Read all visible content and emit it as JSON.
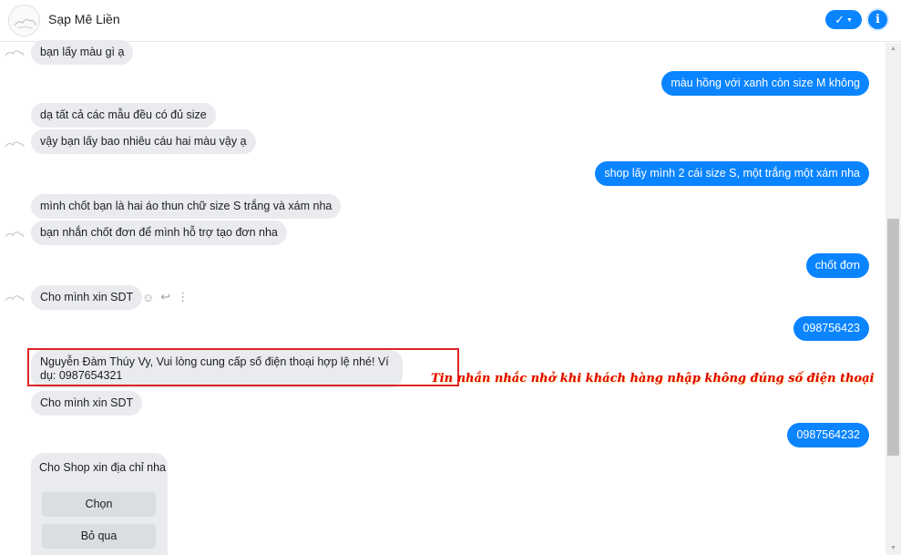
{
  "header": {
    "title": "Sạp Mê Liền",
    "check_icon": "check-icon",
    "info_icon": "info-icon",
    "accent_color": "#0a84ff"
  },
  "messages": [
    {
      "side": "incoming",
      "text": "bạn lấy màu gì ạ"
    },
    {
      "side": "outgoing",
      "text": "màu hồng với xanh còn size M không"
    },
    {
      "side": "incoming",
      "text": "dạ tất cả các mẫu đều có đủ size"
    },
    {
      "side": "incoming",
      "text": "vậy bạn lấy bao nhiêu cáu hai màu vậy ạ"
    },
    {
      "side": "outgoing",
      "text": "shop lấy mình 2 cái size S, một trắng một xám nha"
    },
    {
      "side": "incoming",
      "text": "mình chốt bạn là hai áo thun chữ size S trắng và xám nha"
    },
    {
      "side": "incoming",
      "text": "bạn nhắn chốt đơn để mình hỗ trợ tạo đơn nha"
    },
    {
      "side": "outgoing",
      "text": "chốt đơn"
    },
    {
      "side": "incoming",
      "text": "Cho mình xin  SDT"
    },
    {
      "side": "outgoing",
      "text": "098756423"
    },
    {
      "side": "incoming",
      "text": "Nguyễn Đàm Thúy Vy, Vui lòng cung cấp số điện thoại hợp lệ nhé! Ví dụ: 0987654321"
    },
    {
      "side": "incoming",
      "text": "Cho mình xin  SDT"
    },
    {
      "side": "outgoing",
      "text": "0987564232"
    },
    {
      "side": "incoming",
      "text": "Cho Shop xin địa chỉ nha"
    }
  ],
  "message_actions": [
    "smile-icon",
    "reply-icon",
    "more-icon"
  ],
  "annotation": "Tin nhắn nhắc nhở khi khách hàng nhập không đúng số điện thoại",
  "quick_replies": [
    {
      "label": "Chọn"
    },
    {
      "label": "Bỏ qua"
    }
  ]
}
